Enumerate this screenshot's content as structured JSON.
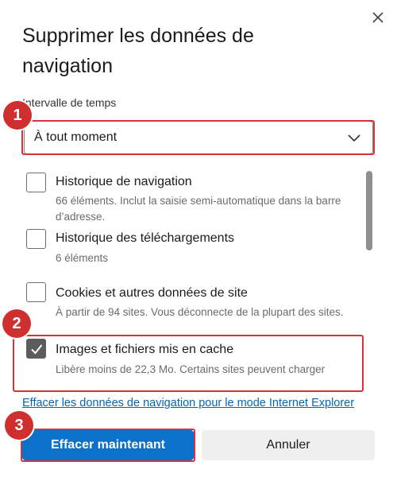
{
  "dialog": {
    "title": "Supprimer les données de navigation",
    "close_icon": "close-icon",
    "time_range": {
      "label": "Intervalle de temps",
      "selected": "À tout moment",
      "icon": "chevron-down-icon"
    },
    "items": [
      {
        "title": "Historique de navigation",
        "description": "66 éléments. Inclut la saisie semi-automatique dans la barre d’adresse.",
        "checked": false
      },
      {
        "title": "Historique des téléchargements",
        "description": "6 éléments",
        "checked": false
      },
      {
        "title": "Cookies et autres données de site",
        "description": "À partir de 94 sites. Vous déconnecte de la plupart des sites.",
        "checked": false
      },
      {
        "title": "Images et fichiers mis en cache",
        "description": "Libère moins de 22,3 Mo. Certains sites peuvent charger",
        "checked": true
      }
    ],
    "ie_link": "Effacer les données de navigation pour le mode Internet Explorer",
    "buttons": {
      "clear_now": "Effacer maintenant",
      "cancel": "Annuler"
    }
  },
  "annotations": {
    "step1": "1",
    "step2": "2",
    "step3": "3",
    "color": "#cf2f2f"
  },
  "colors": {
    "primary": "#0b71c9",
    "link": "#0067b8",
    "highlight": "#d6323a"
  }
}
